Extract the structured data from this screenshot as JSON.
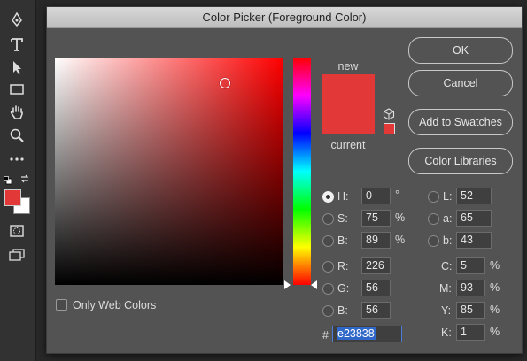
{
  "dialog": {
    "title": "Color Picker (Foreground Color)",
    "buttons": {
      "ok": "OK",
      "cancel": "Cancel",
      "add_to_swatches": "Add to Swatches",
      "color_libraries": "Color Libraries"
    },
    "preview": {
      "new_label": "new",
      "current_label": "current",
      "new_color": "#e23838",
      "current_color": "#e23838"
    },
    "only_web_colors": "Only Web Colors",
    "hsb": [
      {
        "label": "H:",
        "value": "0",
        "unit": "°",
        "selected": true
      },
      {
        "label": "S:",
        "value": "75",
        "unit": "%",
        "selected": false
      },
      {
        "label": "B:",
        "value": "89",
        "unit": "%",
        "selected": false
      }
    ],
    "rgb": [
      {
        "label": "R:",
        "value": "226"
      },
      {
        "label": "G:",
        "value": "56"
      },
      {
        "label": "B:",
        "value": "56"
      }
    ],
    "lab": [
      {
        "label": "L:",
        "value": "52"
      },
      {
        "label": "a:",
        "value": "65"
      },
      {
        "label": "b:",
        "value": "43"
      }
    ],
    "cmyk": [
      {
        "label": "C:",
        "value": "5",
        "unit": "%"
      },
      {
        "label": "M:",
        "value": "93",
        "unit": "%"
      },
      {
        "label": "Y:",
        "value": "85",
        "unit": "%"
      },
      {
        "label": "K:",
        "value": "1",
        "unit": "%"
      }
    ],
    "hex_label": "#",
    "hex_value": "e23838"
  },
  "toolbar": {
    "tools": [
      "pen-icon",
      "type-icon",
      "path-selection-icon",
      "rectangle-icon",
      "hand-icon",
      "zoom-icon",
      "more-tools-icon"
    ],
    "foreground_color": "#e23838",
    "background_color": "#ffffff"
  }
}
